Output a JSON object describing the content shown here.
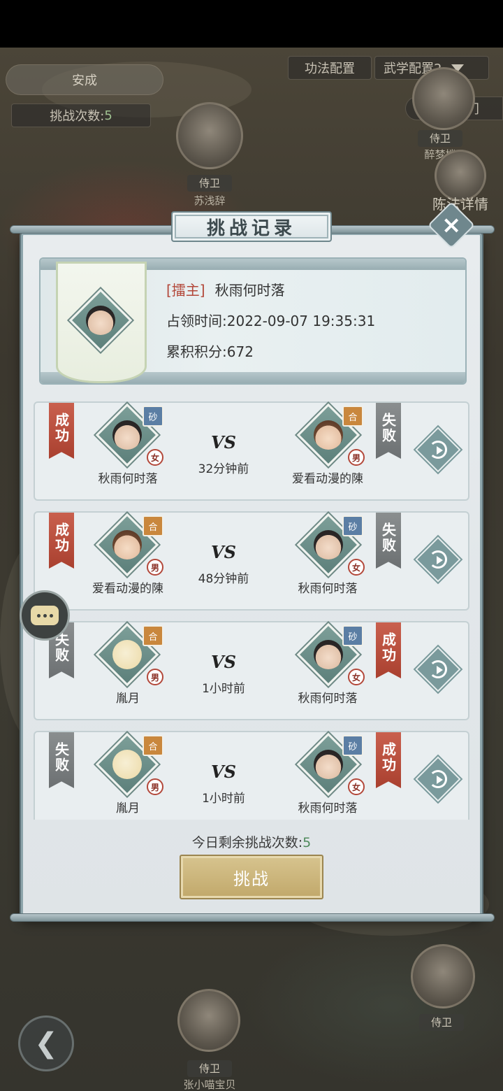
{
  "background": {
    "left_top_pill": "安成",
    "challenge_count_label": "挑战次数:",
    "challenge_count_value": "5",
    "skill_config": "功法配置",
    "martial_config": "武学配置2",
    "return_label": "返回师门",
    "formation_details": "陈法详情",
    "guard_label": "侍卫",
    "npc_name_top": "苏浅辞",
    "npc_name_right": "醉梦楼",
    "npc_name_bottom": "张小喵宝贝"
  },
  "modal": {
    "title": "挑战记录",
    "host": {
      "tag": "[擂主]",
      "name": "秋雨何时落",
      "occupy_label": "占领时间:",
      "occupy_time": "2022-09-07 19:35:31",
      "score_label": "累积积分:",
      "score": "672"
    },
    "records": [
      {
        "left_result": "成功",
        "left_name": "秋雨何时落",
        "left_flag": "砂",
        "left_gender": "女",
        "time_ago": "32分钟前",
        "right_result": "失败",
        "right_name": "爱看动漫的陳",
        "right_flag": "合",
        "right_gender": "男"
      },
      {
        "left_result": "成功",
        "left_name": "爱看动漫的陳",
        "left_flag": "合",
        "left_gender": "男",
        "time_ago": "48分钟前",
        "right_result": "失败",
        "right_name": "秋雨何时落",
        "right_flag": "砂",
        "right_gender": "女"
      },
      {
        "left_result": "失败",
        "left_name": "胤月",
        "left_flag": "合",
        "left_gender": "男",
        "time_ago": "1小时前",
        "right_result": "成功",
        "right_name": "秋雨何时落",
        "right_flag": "砂",
        "right_gender": "女"
      },
      {
        "left_result": "失败",
        "left_name": "胤月",
        "left_flag": "合",
        "left_gender": "男",
        "time_ago": "1小时前",
        "right_result": "成功",
        "right_name": "秋雨何时落",
        "right_flag": "砂",
        "right_gender": "女"
      }
    ],
    "vs_text": "VS",
    "remaining_label": "今日剩余挑战次数:",
    "remaining_value": "5",
    "challenge_button": "挑战"
  },
  "colors": {
    "win_badge": "#b84d3c",
    "lose_badge": "#7a7e80",
    "challenge_button": "#c9b27a",
    "accent_text_red": "#b3483a"
  },
  "icons": [
    "close-icon",
    "replay-icon",
    "chat-icon",
    "back-arrow-icon",
    "dropdown-triangle-icon"
  ]
}
